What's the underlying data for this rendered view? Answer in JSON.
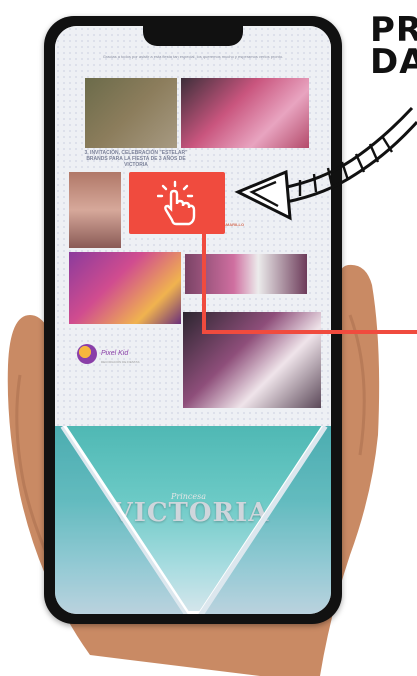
{
  "heading": {
    "line1": "PR",
    "line2": "DA"
  },
  "phone_page": {
    "intro_text": "Gracias a todos por asistir a esta fiesta tan especial, los queremos mucho y esperamos verlos pronto.",
    "section_heading": "3. INVITACIÓN, CELEBRACIÓN \"ESTELAR\" BRANDS PARA LA FIESTA DE 3 AÑOS DE VICTORIA",
    "small_caption": "AMARILLO",
    "logo_text": "Pixel Kid",
    "logo_sub": "DECORACIÓN DE FIESTAS",
    "video_prefix": "Princesa",
    "video_banner": "VICTORIA"
  },
  "colors": {
    "accent": "#f04b3e",
    "tap_icon": "#ffffff"
  },
  "icons": {
    "tap": "pointer-tap-icon",
    "arrow": "arrow-icon",
    "play": "play-triangle-icon"
  }
}
